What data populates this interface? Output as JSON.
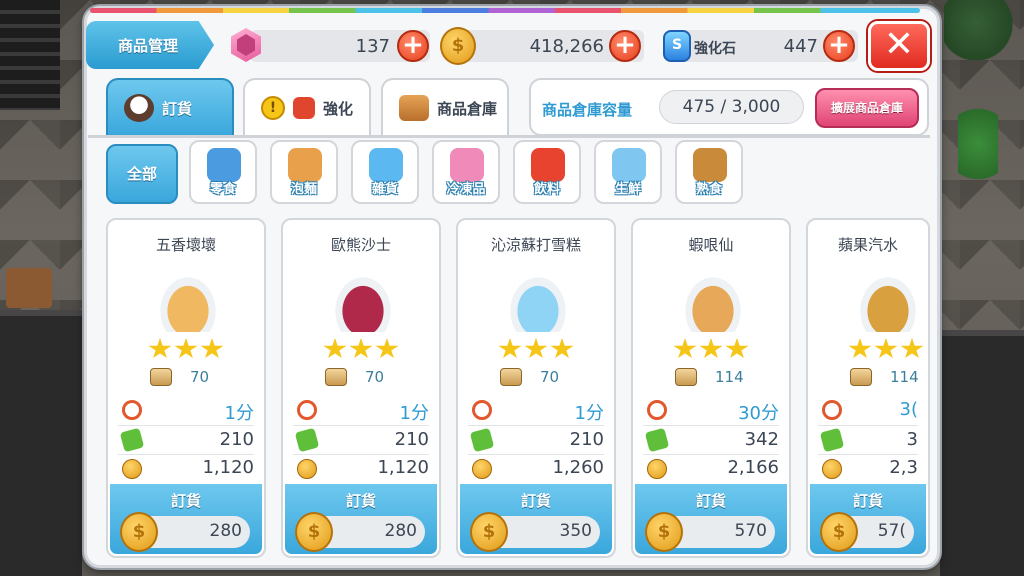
{
  "header": {
    "title": "商品管理",
    "gems": "137",
    "coins": "418,266",
    "stone_label": "強化石",
    "stone_icon_letter": "S",
    "stones": "447"
  },
  "tabs": [
    {
      "label": "訂貨",
      "active": true
    },
    {
      "label": "強化",
      "active": false
    },
    {
      "label": "商品倉庫",
      "active": false
    }
  ],
  "capacity": {
    "label": "商品倉庫容量",
    "value": "475 / 3,000",
    "expand_label": "擴展商品倉庫"
  },
  "categories": {
    "all_label": "全部",
    "items": [
      {
        "label": "零食",
        "color": "#4a9be0"
      },
      {
        "label": "泡麵",
        "color": "#e8a04a"
      },
      {
        "label": "雜貨",
        "color": "#5cb8f0"
      },
      {
        "label": "冷凍品",
        "color": "#f08ab8"
      },
      {
        "label": "飲料",
        "color": "#e8432e"
      },
      {
        "label": "生鮮",
        "color": "#7fc7f0"
      },
      {
        "label": "熟食",
        "color": "#c98a3a"
      }
    ]
  },
  "products": [
    {
      "name": "五香壞壞",
      "stock": "70",
      "time": "1分",
      "exp": "210",
      "profit": "1,120",
      "order_label": "訂貨",
      "price": "280",
      "stars": 3,
      "img_color": "#f0b860"
    },
    {
      "name": "歐熊沙士",
      "stock": "70",
      "time": "1分",
      "exp": "210",
      "profit": "1,120",
      "order_label": "訂貨",
      "price": "280",
      "stars": 3,
      "img_color": "#b0284a"
    },
    {
      "name": "沁涼蘇打雪糕",
      "stock": "70",
      "time": "1分",
      "exp": "210",
      "profit": "1,260",
      "order_label": "訂貨",
      "price": "350",
      "stars": 3,
      "img_color": "#8fd4f5"
    },
    {
      "name": "蝦哏仙",
      "stock": "114",
      "time": "30分",
      "exp": "342",
      "profit": "2,166",
      "order_label": "訂貨",
      "price": "570",
      "stars": 3,
      "img_color": "#e8a85a"
    },
    {
      "name": "蘋果汽水",
      "stock": "114",
      "time": "3(",
      "exp": "3",
      "profit": "2,3",
      "order_label": "訂貨",
      "price": "57(",
      "stars": 3,
      "img_color": "#d9a040"
    }
  ]
}
